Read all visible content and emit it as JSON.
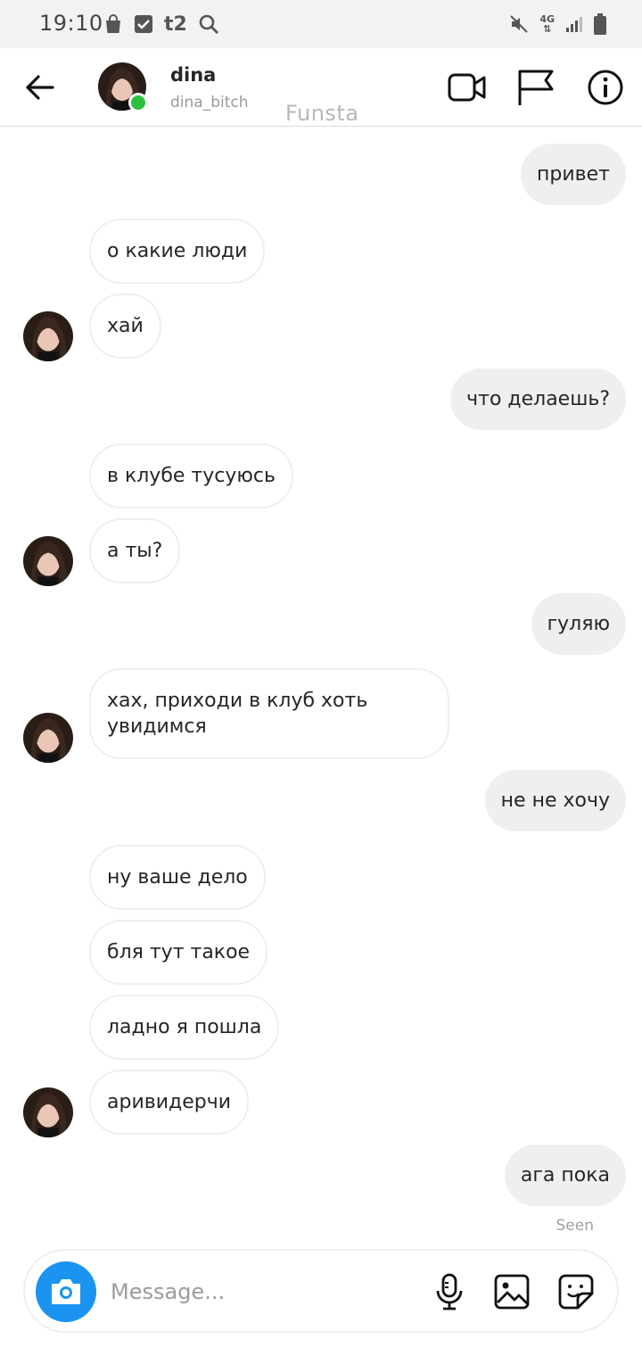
{
  "status_bar": {
    "time": "19:10",
    "carrier_badge": "t2",
    "network": "4G",
    "left_icons": [
      "shopping-bag-icon",
      "checkbox-icon",
      "t2-icon",
      "search-icon"
    ],
    "right_icons": [
      "mute-icon",
      "network-4g-icon",
      "signal-icon",
      "battery-icon"
    ]
  },
  "header": {
    "name": "dina",
    "username": "dina_bitch",
    "watermark": "Funsta",
    "online_color": "#2bc140",
    "icons": [
      "back-arrow-icon",
      "video-call-icon",
      "flag-icon",
      "info-icon"
    ]
  },
  "messages": [
    {
      "direction": "out",
      "text": "привет"
    },
    {
      "direction": "in",
      "text": "о какие люди"
    },
    {
      "direction": "in",
      "text": "хай"
    },
    {
      "direction": "out",
      "text": "что делаешь?"
    },
    {
      "direction": "in",
      "text": "в клубе тусуюсь"
    },
    {
      "direction": "in",
      "text": "а ты?"
    },
    {
      "direction": "out",
      "text": "гуляю"
    },
    {
      "direction": "in",
      "text": "хах, приходи в клуб хоть увидимся"
    },
    {
      "direction": "out",
      "text": "не не хочу"
    },
    {
      "direction": "in",
      "text": "ну ваше дело"
    },
    {
      "direction": "in",
      "text": "бля тут такое"
    },
    {
      "direction": "in",
      "text": "ладно я пошла"
    },
    {
      "direction": "in",
      "text": "аривидерчи"
    },
    {
      "direction": "out",
      "text": "ага пока"
    }
  ],
  "seen_label": "Seen",
  "composer": {
    "placeholder": "Message...",
    "accent_color": "#1a94f0",
    "icons": [
      "camera-icon",
      "microphone-icon",
      "gallery-icon",
      "sticker-icon"
    ]
  }
}
